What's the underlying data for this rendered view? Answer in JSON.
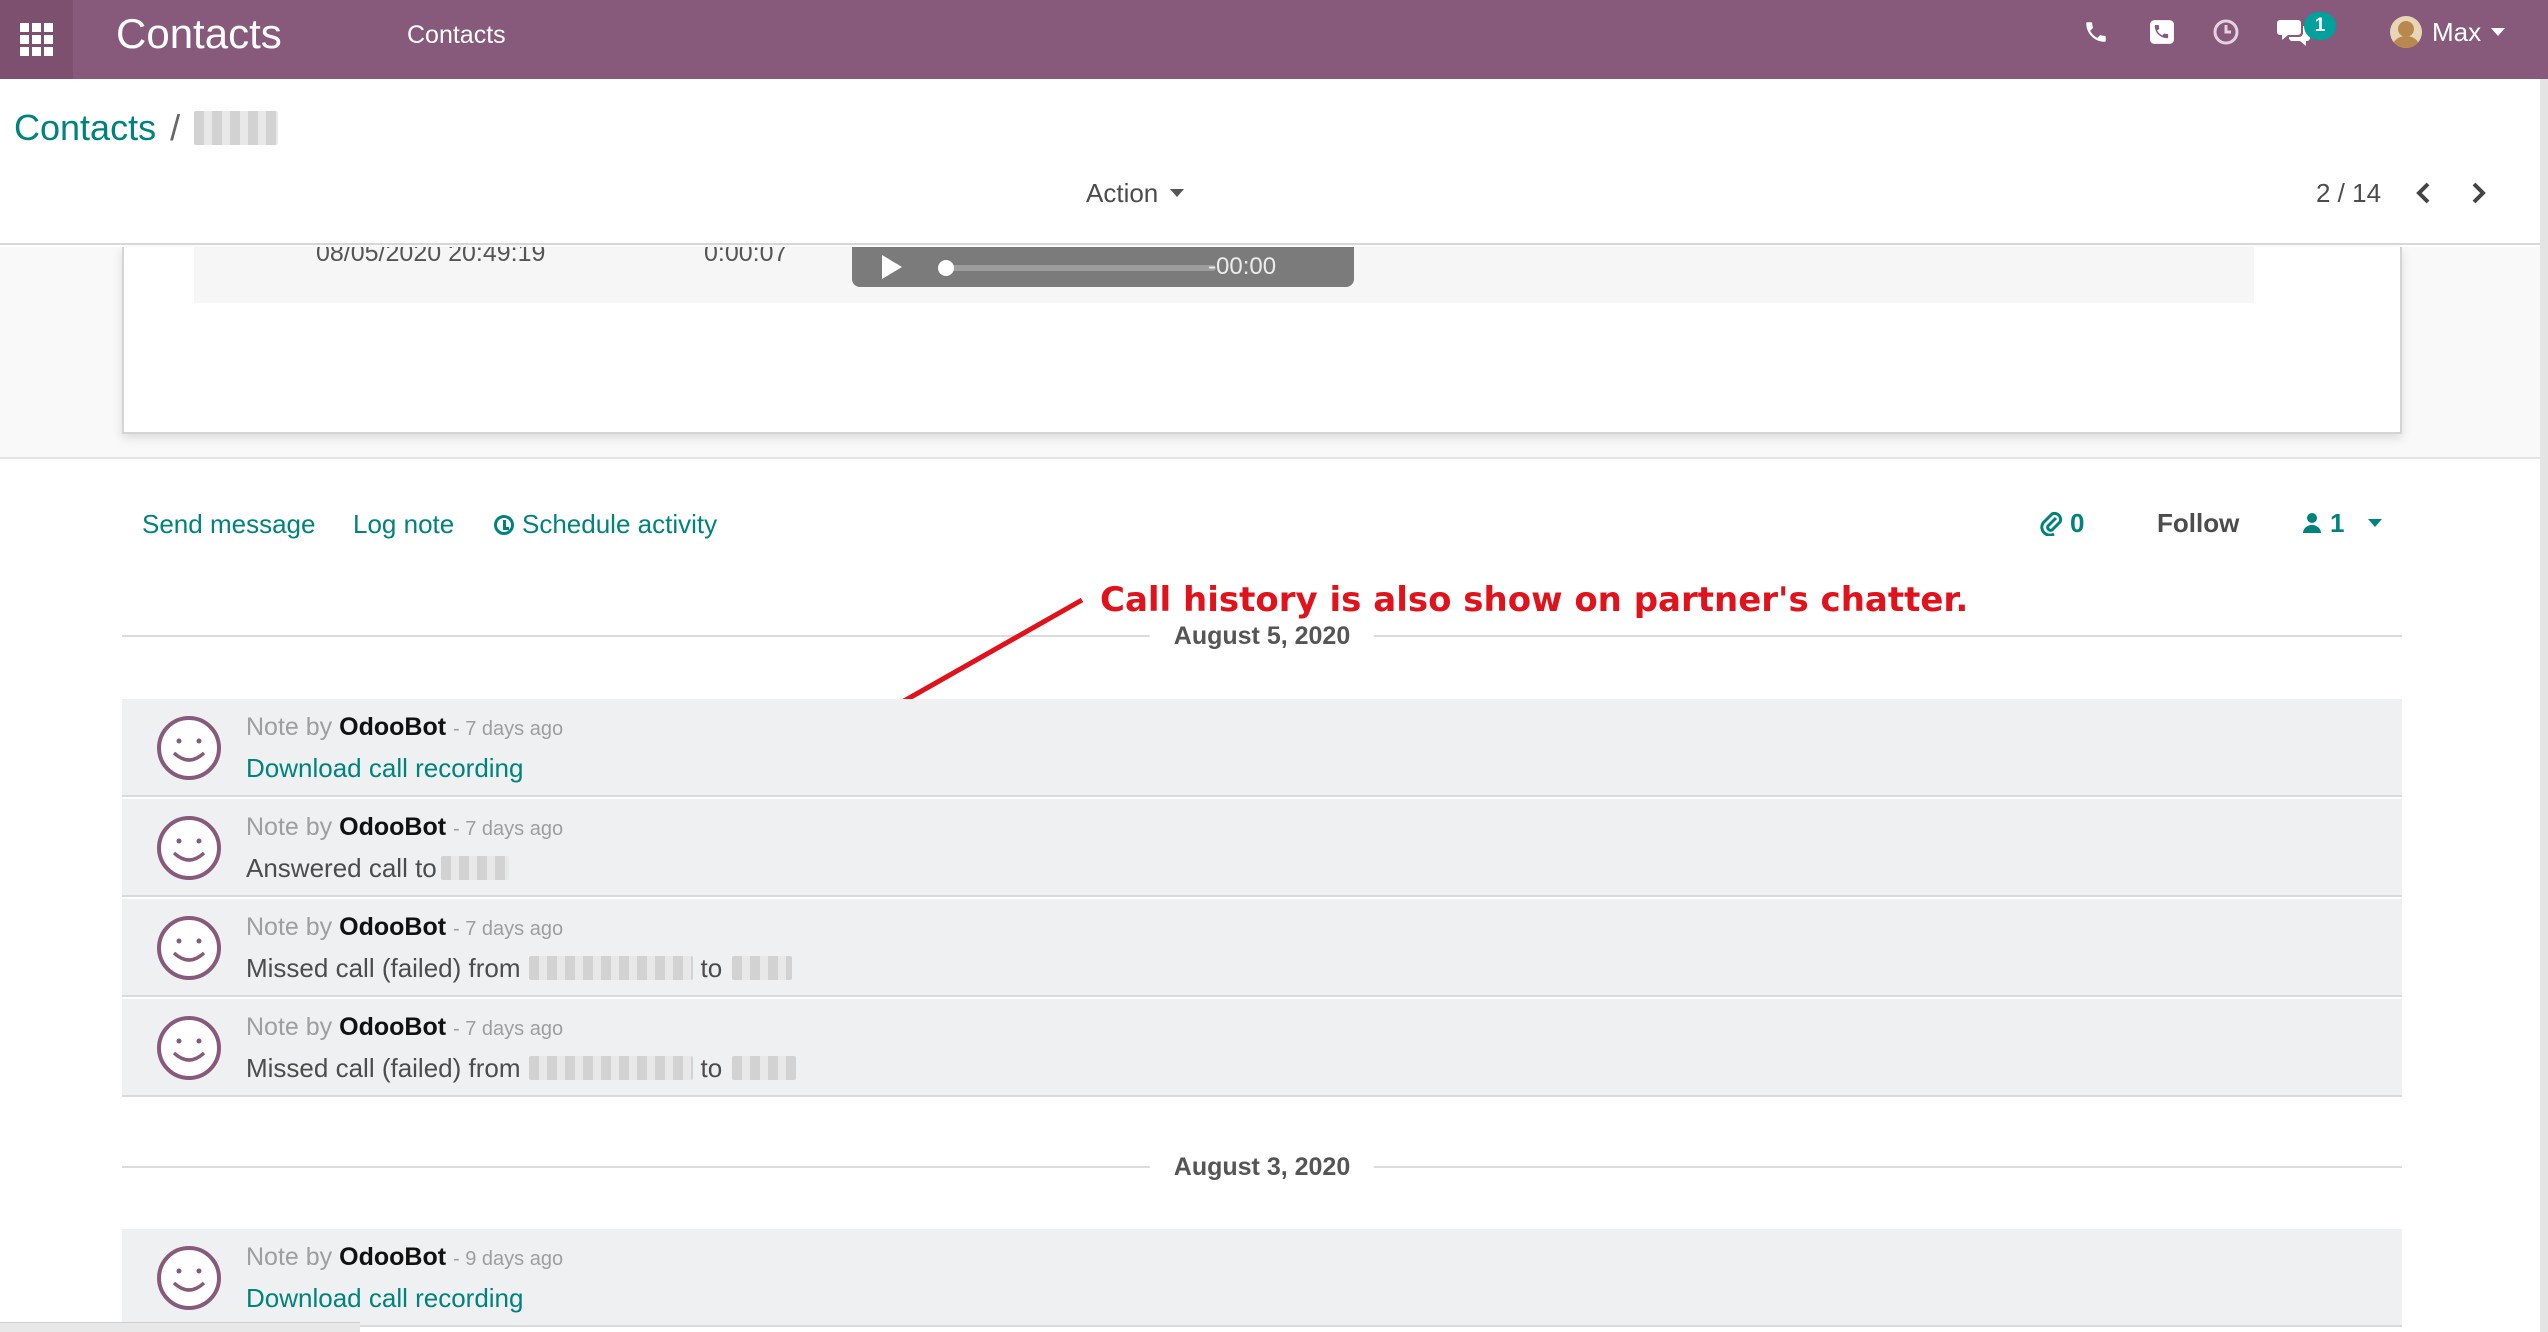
{
  "navbar": {
    "app_title": "Contacts",
    "menu_item": "Contacts",
    "messages_badge": "1",
    "user_name": "Max",
    "icons": [
      "phone-icon",
      "voip-phone-icon",
      "activity-clock-icon",
      "messages-icon"
    ]
  },
  "control_panel": {
    "breadcrumb_root": "Contacts",
    "breadcrumb_separator": "/",
    "action_label": "Action",
    "pager": "2 / 14"
  },
  "call_log": {
    "date": "08/05/2020 20:49:19",
    "duration": "0:00:07",
    "audio_time": "-00:00"
  },
  "chatter": {
    "send_message": "Send message",
    "log_note": "Log note",
    "schedule_activity": "Schedule activity",
    "attachments_count": "0",
    "follow_label": "Follow",
    "followers_count": "1"
  },
  "annotation": {
    "text": "Call history is also show on partner's chatter."
  },
  "groups": [
    {
      "date": "August 5, 2020",
      "messages": [
        {
          "prefix": "Note by",
          "author": "OdooBot",
          "date": "- 7 days ago",
          "body": "Download call recording"
        },
        {
          "prefix": "Note by",
          "author": "OdooBot",
          "date": "- 7 days ago",
          "body": "Answered call to"
        },
        {
          "prefix": "Note by",
          "author": "OdooBot",
          "date": "- 7 days ago",
          "body": "Missed call (failed) from",
          "body_mid": "to"
        },
        {
          "prefix": "Note by",
          "author": "OdooBot",
          "date": "- 7 days ago",
          "body": "Missed call (failed) from",
          "body_mid": "to"
        }
      ]
    },
    {
      "date": "August 3, 2020",
      "messages": [
        {
          "prefix": "Note by",
          "author": "OdooBot",
          "date": "- 9 days ago",
          "body": "Download call recording"
        }
      ]
    }
  ],
  "colors": {
    "navbar": "#875a7b",
    "link": "#00827d",
    "annotation": "#e0121b",
    "badge": "#00a09d"
  }
}
